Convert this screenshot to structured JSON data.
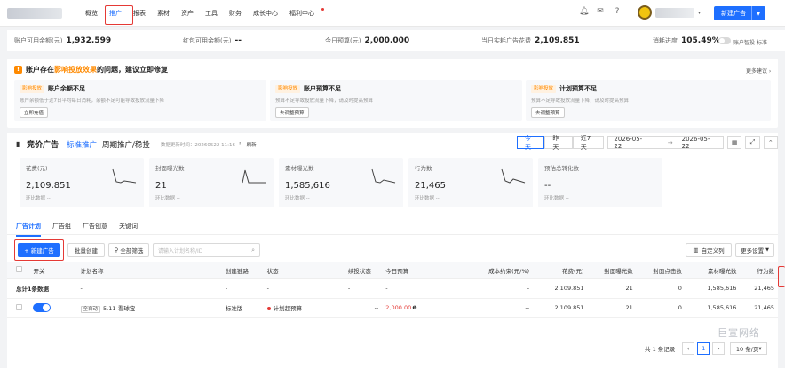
{
  "nav": {
    "menu": [
      "概览",
      "推广",
      "报表",
      "素材",
      "资产",
      "工具",
      "财务",
      "成长中心",
      "福利中心"
    ],
    "active": "推广",
    "new_ad": "新建广告"
  },
  "stats": {
    "balance_label": "账户可用余额(元)",
    "balance": "1,932.599",
    "redpack_label": "红包可用余额(元)",
    "redpack": "--",
    "budget_label": "今日预算(元)",
    "budget": "2,000.000",
    "spend_label": "当日实耗广告花费",
    "spend": "2,109.851",
    "progress_label": "消耗进度",
    "progress": "105.49%",
    "smart_label": "账户智投-标准"
  },
  "alert": {
    "prefix": "账户存在",
    "highlight": "影响投放效果",
    "suffix": "的问题，建议立即修复",
    "more": "更多建议",
    "cards": [
      {
        "tag": "影响投放",
        "title": "账户余额不足",
        "desc": "账户余额低于近7日平均每日消耗，余额不足可能导致投放流量下降",
        "btn": "立即充值"
      },
      {
        "tag": "影响投放",
        "title": "账户预算不足",
        "desc": "预算不足导致投放流量下降，请及时提高预算",
        "btn": "去调整预算"
      },
      {
        "tag": "影响投放",
        "title": "计划预算不足",
        "desc": "预算不足导致投放流量下降，请及时提高预算",
        "btn": "去调整预算"
      }
    ]
  },
  "header": {
    "title": "竞价广告",
    "mode": "标准推广",
    "period": "周期推广/稳投",
    "update_label": "数据更新时间：20260522 11:16",
    "refresh": "刷新",
    "dates": [
      "今天",
      "昨天",
      "近7天"
    ],
    "date_start": "2026-05-22",
    "date_sep": "→",
    "date_end": "2026-05-22"
  },
  "metrics": [
    {
      "label": "花费(元)",
      "value": "2,109.851",
      "cmp": "环比数据 --"
    },
    {
      "label": "封面曝光数",
      "value": "21",
      "cmp": "环比数据 --"
    },
    {
      "label": "素材曝光数",
      "value": "1,585,616",
      "cmp": "环比数据 --"
    },
    {
      "label": "行为数",
      "value": "21,465",
      "cmp": "环比数据 --"
    },
    {
      "label": "预估总转化数",
      "value": "--",
      "cmp": "环比数据 --"
    }
  ],
  "tabs": [
    "广告计划",
    "广告组",
    "广告创意",
    "关键词"
  ],
  "toolbar": {
    "new_ad": "+ 新建广告",
    "batch": "批量创建",
    "filter": "全部筛选",
    "search_placeholder": "请输入计划名称/ID",
    "custom_cols": "自定义列",
    "more_settings": "更多设置"
  },
  "table": {
    "headers": [
      "开关",
      "计划名称",
      "创建链路",
      "状态",
      "续投状态",
      "今日预算",
      "成本约束(元/%)",
      "花费(元)",
      "封面曝光数",
      "封面点击数",
      "素材曝光数",
      "行为数"
    ],
    "total": {
      "label": "总计1条数据",
      "name": "-",
      "chain": "-",
      "status": "-",
      "renew": "-",
      "budget": "-",
      "cost": "-",
      "spend": "2,109.851",
      "cover_exp": "21",
      "cover_click": "0",
      "mat_exp": "1,585,616",
      "actions": "21,465"
    },
    "rows": [
      {
        "tag": "全自动",
        "name": "5.11-看球宝",
        "chain": "标准版",
        "status": "计划超预算",
        "renew": "--",
        "budget": "2,000.00",
        "cost": "--",
        "spend": "2,109.851",
        "cover_exp": "21",
        "cover_click": "0",
        "mat_exp": "1,585,616",
        "actions": "21,465"
      }
    ]
  },
  "pager": {
    "total": "共 1 条记录",
    "page": "1",
    "size": "10 条/页"
  },
  "watermark": "巨宣网络"
}
